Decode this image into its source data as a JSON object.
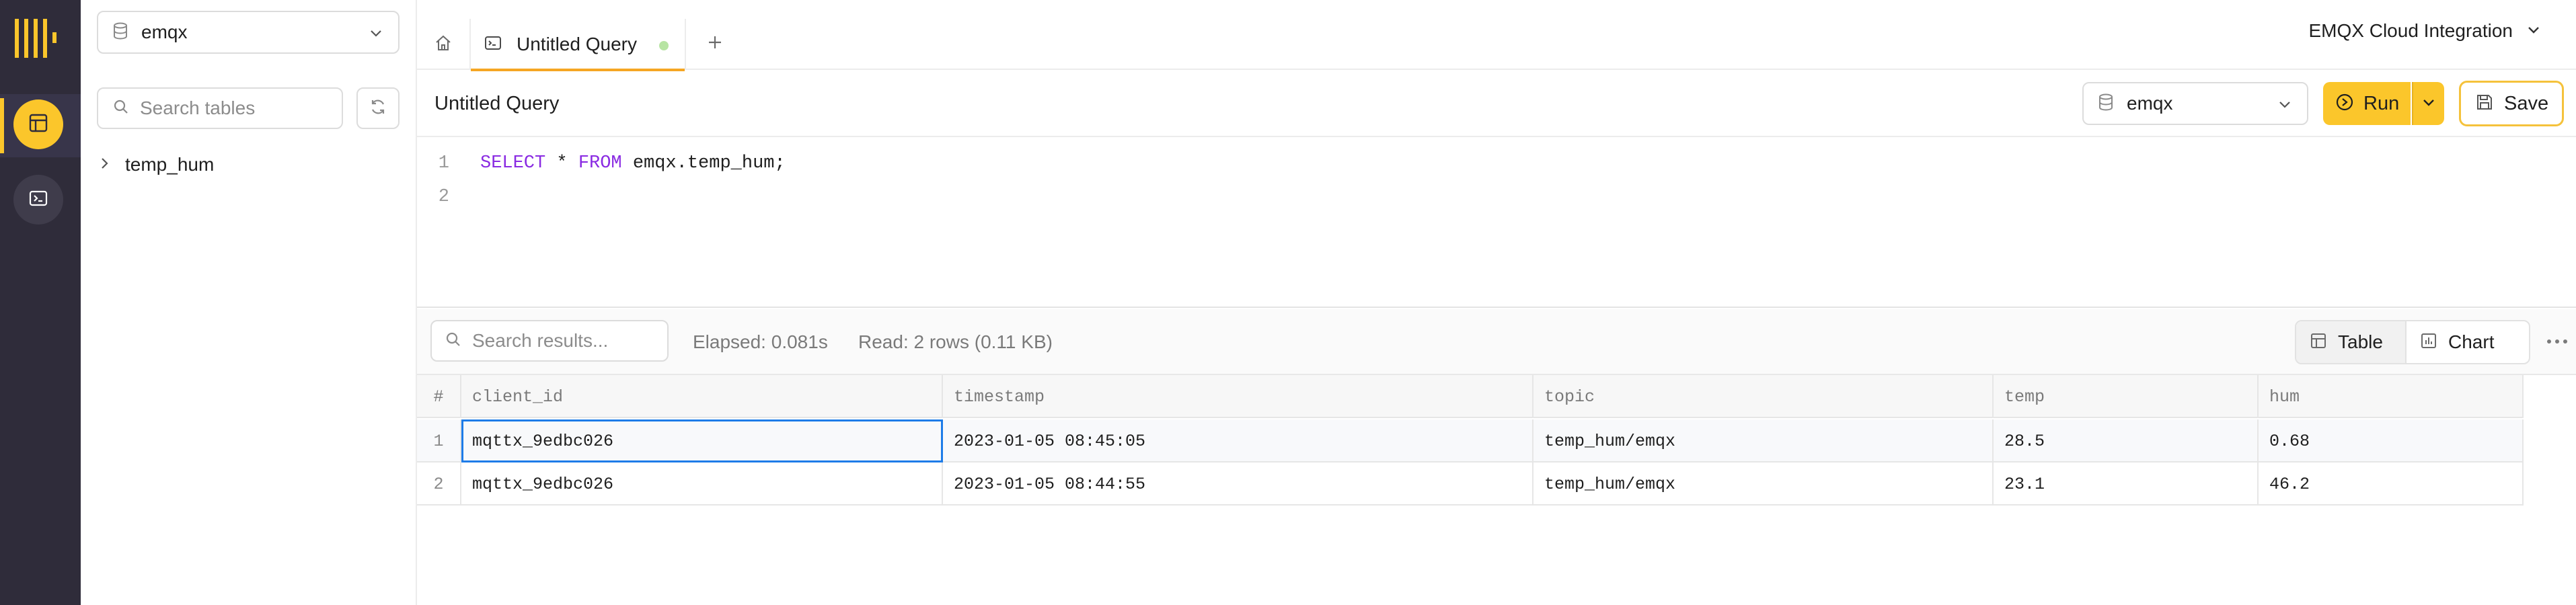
{
  "rail": {
    "icons": [
      "logo-icon",
      "table-icon",
      "terminal-icon"
    ]
  },
  "sidebar": {
    "database": "emqx",
    "search_placeholder": "Search tables",
    "tables": [
      {
        "name": "temp_hum"
      }
    ]
  },
  "tabs": {
    "active_tab": "Untitled Query",
    "org_name": "EMQX Cloud Integration"
  },
  "query": {
    "title": "Untitled Query",
    "database": "emqx",
    "run_label": "Run",
    "save_label": "Save",
    "code_lines": [
      {
        "num": "1",
        "parts": [
          {
            "text": "SELECT",
            "kw": true
          },
          {
            "text": " * ",
            "kw": false
          },
          {
            "text": "FROM",
            "kw": true
          },
          {
            "text": " emqx.temp_hum;",
            "kw": false
          }
        ]
      },
      {
        "num": "2",
        "parts": []
      }
    ]
  },
  "results": {
    "search_placeholder": "Search results...",
    "elapsed": "Elapsed: 0.081s",
    "read": "Read: 2 rows (0.11 KB)",
    "view_table": "Table",
    "view_chart": "Chart",
    "columns": [
      "#",
      "client_id",
      "timestamp",
      "topic",
      "temp",
      "hum"
    ],
    "rows": [
      [
        "1",
        "mqttx_9edbc026",
        "2023-01-05 08:45:05",
        "temp_hum/emqx",
        "28.5",
        "0.68"
      ],
      [
        "2",
        "mqttx_9edbc026",
        "2023-01-05 08:44:55",
        "temp_hum/emqx",
        "23.1",
        "46.2"
      ]
    ]
  },
  "colors": {
    "accent": "#fbc62b",
    "rail_bg": "#2f2c3a",
    "keyword": "#8a2be2",
    "selection": "#1e7ce8"
  }
}
